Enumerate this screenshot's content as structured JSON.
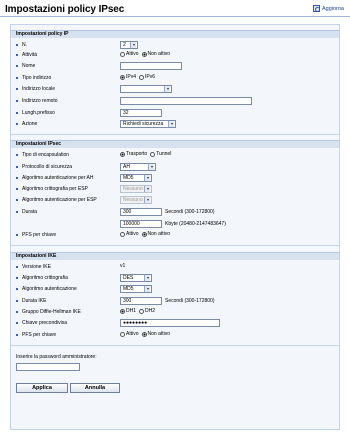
{
  "header": {
    "title": "Impostazioni policy IPsec",
    "refresh_label": "Aggiorna"
  },
  "sections": {
    "policy_ip": {
      "title": "Impostazioni policy IP",
      "no_label": "N.",
      "no_value": "2",
      "status_label": "Attività",
      "status_opt_active": "Attivo",
      "status_opt_inactive": "Non attivo",
      "name_label": "Nome",
      "name_value": "",
      "addr_type_label": "Tipo indirizzo",
      "addr_opt_ipv4": "IPv4",
      "addr_opt_ipv6": "IPv6",
      "local_addr_label": "Indirizzo locale",
      "local_addr_value": "",
      "remote_addr_label": "Indirizzo remoto",
      "remote_addr_value": "",
      "prefix_label": "Lungh.prefisso",
      "prefix_value": "32",
      "action_label": "Azione",
      "action_value": "Richiedi sicurezza"
    },
    "ipsec": {
      "title": "Impostazioni IPsec",
      "encap_label": "Tipo di encapsulation",
      "encap_opt_transport": "Trasporto",
      "encap_opt_tunnel": "Tunnel",
      "protocol_label": "Protocollo di sicurezza",
      "protocol_value": "AH",
      "ah_auth_label": "Algoritmo autenticazione per AH",
      "ah_auth_value": "MD5",
      "esp_enc_label": "Algoritmo crittografia per ESP",
      "esp_enc_value": "Nessuno",
      "esp_auth_label": "Algoritmo autenticazione per ESP",
      "esp_auth_value": "Nessuno",
      "duration_label": "Durata",
      "duration_sec_value": "300",
      "duration_sec_unit": "Secondi (300-172800)",
      "duration_kb_value": "100000",
      "duration_kb_unit": "Kbyte (20480-2147483647)",
      "pfs_label": "PFS per chiave",
      "pfs_opt_active": "Attivo",
      "pfs_opt_inactive": "Non attivo"
    },
    "ike": {
      "title": "Impostazioni IKE",
      "version_label": "Versione IKE",
      "version_value": "v1",
      "enc_label": "Algoritmo crittografia",
      "enc_value": "DES",
      "auth_label": "Algoritmo autenticazione",
      "auth_value": "MD5",
      "duration_label": "Durata IKE",
      "duration_value": "300",
      "duration_unit": "Secondi (300-172800)",
      "dh_label": "Gruppo Diffie-Hellman IKE",
      "dh_opt_1": "DH1",
      "dh_opt_2": "DH2",
      "psk_label": "Chiave precondivisa",
      "psk_value": "●●●●●●●●",
      "pfs_label": "PFS per chiave",
      "pfs_opt_active": "Attivo",
      "pfs_opt_inactive": "Non attivo"
    }
  },
  "admin": {
    "password_prompt": "Inserire la password amministratore:",
    "password_value": ""
  },
  "buttons": {
    "apply": "Applica",
    "cancel": "Annulla"
  }
}
